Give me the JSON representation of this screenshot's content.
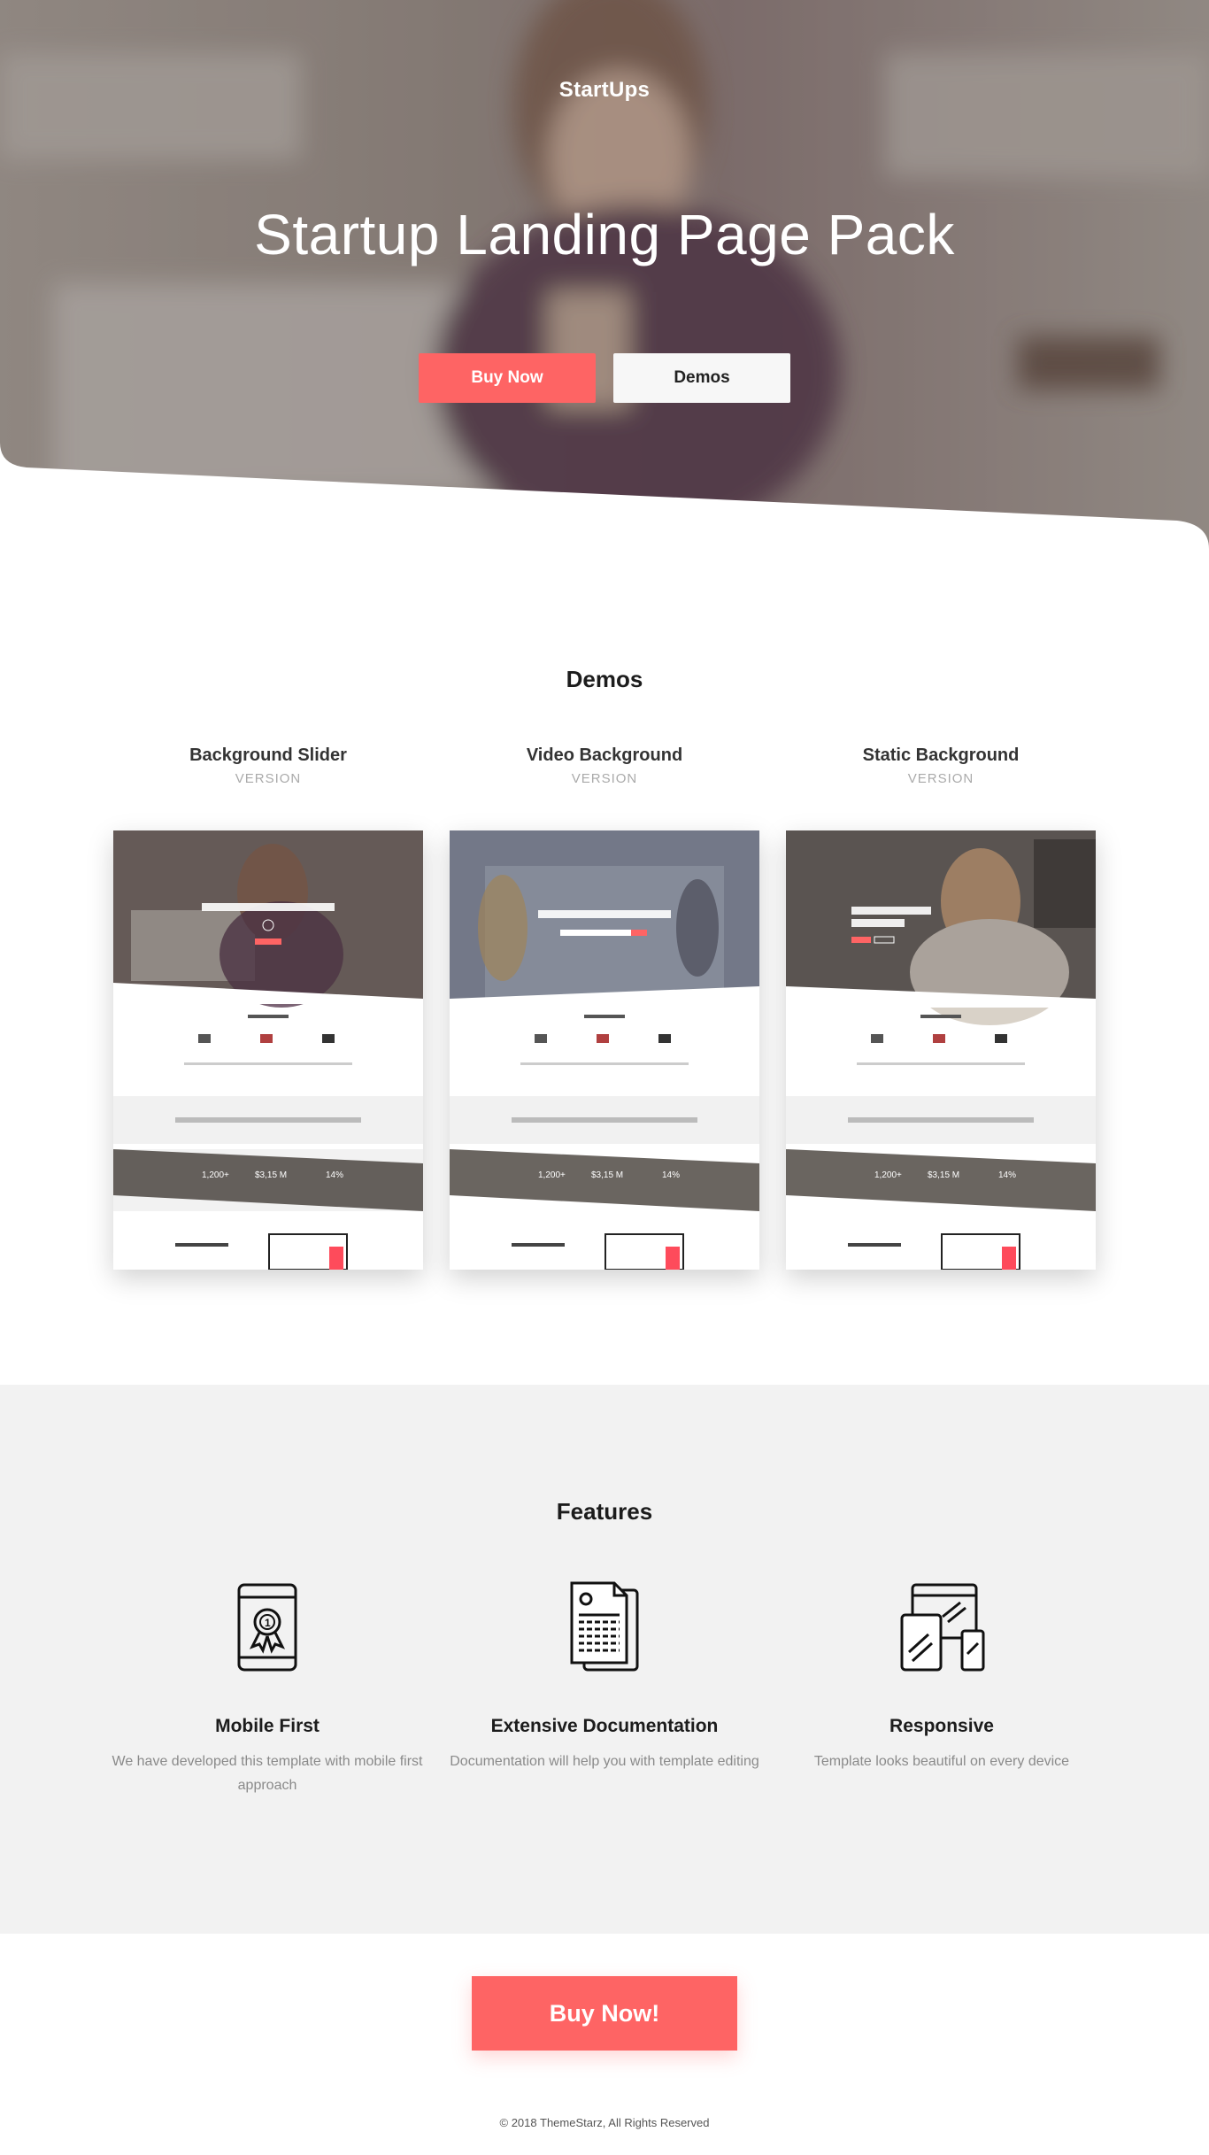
{
  "hero": {
    "brand": "StartUps",
    "title": "Startup Landing Page Pack",
    "buy_label": "Buy Now",
    "demos_label": "Demos"
  },
  "demos": {
    "title": "Demos",
    "items": [
      {
        "name": "Background Slider",
        "sub": "VERSION"
      },
      {
        "name": "Video Background",
        "sub": "VERSION"
      },
      {
        "name": "Static Background",
        "sub": "VERSION"
      }
    ]
  },
  "features": {
    "title": "Features",
    "items": [
      {
        "title": "Mobile First",
        "desc": "We have developed this template with mobile first approach",
        "icon": "mobile-award-icon"
      },
      {
        "title": "Extensive Documentation",
        "desc": "Documentation will help you with template editing",
        "icon": "documentation-icon"
      },
      {
        "title": "Responsive",
        "desc": "Template looks beautiful on every device",
        "icon": "responsive-devices-icon"
      }
    ]
  },
  "cta": {
    "label": "Buy Now!"
  },
  "footer": {
    "copyright": "© 2018 ThemeStarz, All Rights Reserved"
  },
  "colors": {
    "accent": "#fe6464",
    "features_bg": "#f2f2f2"
  }
}
